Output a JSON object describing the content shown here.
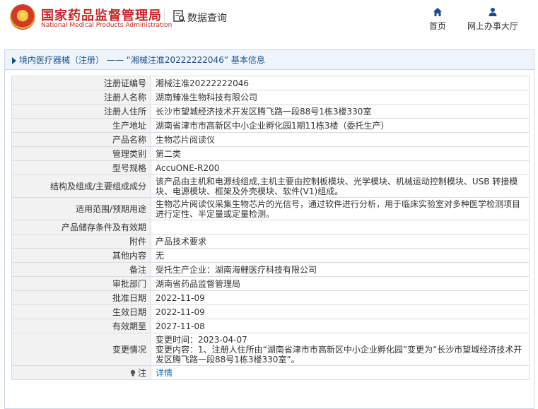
{
  "header": {
    "brand_cn": "国家药品监督管理局",
    "brand_en": "National Medical Products Administration",
    "query_label": "数据查询",
    "nav_home": "首页",
    "nav_hall": "网上办事大厅",
    "brand_color": "#c62828"
  },
  "panel": {
    "title": "境内医疗器械（注册） —— “湘械注准20222222046” 基本信息"
  },
  "rows": [
    {
      "label": "注册证编号",
      "value": "湘械注准20222222046"
    },
    {
      "label": "注册人名称",
      "value": "湖南臻准生物科技有限公司"
    },
    {
      "label": "注册人住所",
      "value": "长沙市望城经济技术开发区腾飞路一段88号1栋3楼330室"
    },
    {
      "label": "生产地址",
      "value": "湖南省津市市高新区中小企业孵化园1期11栋3楼（委托生产）"
    },
    {
      "label": "产品名称",
      "value": "生物芯片阅读仪"
    },
    {
      "label": "管理类别",
      "value": "第二类"
    },
    {
      "label": "型号规格",
      "value": "AccuONE-R200"
    },
    {
      "label": "结构及组成/主要组成成分",
      "value": "该产品由主机和电源线组成,主机主要由控制板模块、光学模块、机械运动控制模块、USB 转接模块、电源模块、框架及外壳模块、软件(V1)组成。"
    },
    {
      "label": "适用范围/预期用途",
      "value": "生物芯片阅读仪采集生物芯片的光信号，通过软件进行分析，用于临床实验室对多种医学检测项目进行定性、半定量或定量检测。"
    },
    {
      "label": "产品储存条件及有效期",
      "value": ""
    },
    {
      "label": "附件",
      "value": "产品技术要求"
    },
    {
      "label": "其他内容",
      "value": "无"
    },
    {
      "label": "备注",
      "value": "受托生产企业：湖南海鲤医疗科技有限公司"
    },
    {
      "label": "审批部门",
      "value": "湖南省药品监督管理局"
    },
    {
      "label": "批准日期",
      "value": "2022-11-09"
    },
    {
      "label": "生效日期",
      "value": "2022-11-09"
    },
    {
      "label": "有效期至",
      "value": "2027-11-08"
    },
    {
      "label": "变更情况",
      "value": "变更时间：2023-04-07\n变更内容：1、注册人住所由“湖南省津市市高新区中小企业孵化园”变更为“长沙市望城经济技术开发区腾飞路一段88号1栋3楼330室”。"
    },
    {
      "label": "注",
      "value": "详情"
    }
  ]
}
